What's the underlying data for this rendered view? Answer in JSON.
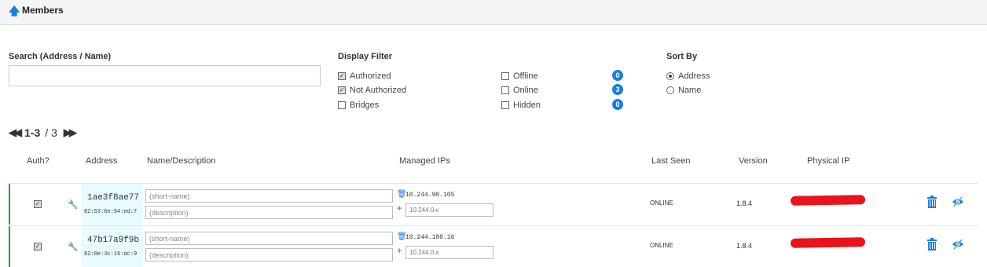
{
  "header": {
    "title": "Members",
    "icon": "arrow-up-icon"
  },
  "search": {
    "label": "Search (Address / Name)",
    "value": ""
  },
  "display_filter": {
    "label": "Display Filter",
    "options": [
      {
        "label": "Authorized",
        "checked": true
      },
      {
        "label": "Not Authorized",
        "checked": true
      },
      {
        "label": "Bridges",
        "checked": false
      },
      {
        "label": "Offline",
        "checked": false,
        "count": "0"
      },
      {
        "label": "Online",
        "checked": false,
        "count": "3"
      },
      {
        "label": "Hidden",
        "checked": false,
        "count": "0"
      }
    ]
  },
  "sort_by": {
    "label": "Sort By",
    "options": [
      {
        "label": "Address",
        "selected": true
      },
      {
        "label": "Name",
        "selected": false
      }
    ]
  },
  "pagination": {
    "range": "1-3",
    "separator": "/",
    "total": "3"
  },
  "table": {
    "columns": [
      "Auth?",
      "Address",
      "Name/Description",
      "Managed IPs",
      "Last Seen",
      "Version",
      "Physical IP"
    ],
    "rows": [
      {
        "authorized": true,
        "node_id": "1ae3f8ae77",
        "mac": "82:53:6e:94:ed:7",
        "name_placeholder": "(short-name)",
        "description_placeholder": "(description)",
        "managed_ip": "10.244.90.105",
        "ip_placeholder": "10.244.0.x",
        "last_seen": "ONLINE",
        "version": "1.8.4"
      },
      {
        "authorized": true,
        "node_id": "47b17a9f9b",
        "mac": "82:0e:3c:16:dc:9",
        "name_placeholder": "(short-name)",
        "description_placeholder": "(description)",
        "managed_ip": "10.244.180.16",
        "ip_placeholder": "10.244.0.x",
        "last_seen": "ONLINE",
        "version": "1.8.4"
      }
    ]
  },
  "colors": {
    "accent": "#1a7ee0",
    "online_bar": "#2ca02c",
    "address_bg": "#e8fbff",
    "redaction": "#e8141a"
  }
}
